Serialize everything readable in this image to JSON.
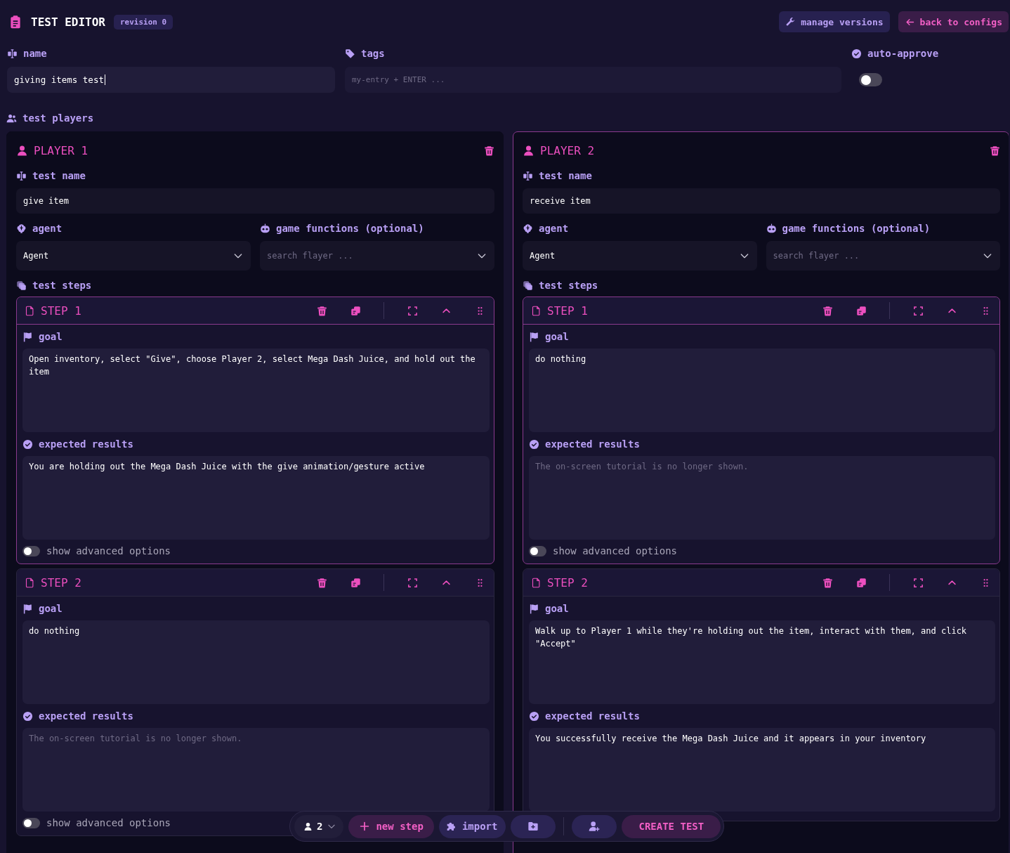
{
  "header": {
    "title": "TEST EDITOR",
    "badge": "revision 0",
    "buttons": [
      {
        "kind": "tool",
        "label": "manage versions"
      },
      {
        "kind": "back",
        "label": "back to configs"
      }
    ]
  },
  "fields": {
    "name": {
      "label": "name",
      "value": "giving items test"
    },
    "tags": {
      "label": "tags",
      "placeholder": "my-entry + ENTER ..."
    },
    "auto_approve": {
      "label": "auto-approve",
      "on": false
    }
  },
  "players_label": "test players",
  "players": [
    {
      "title": "PLAYER 1",
      "selected": false,
      "test_name_label": "test name",
      "test_name": "give item",
      "agent_label": "agent",
      "agent": "Agent",
      "functions_label": "game functions (optional)",
      "functions_placeholder": "search flayer ...",
      "steps_label": "test steps",
      "steps": [
        {
          "title": "STEP 1",
          "selected": true,
          "goal_label": "goal",
          "goal": {
            "value": "Open inventory, select \"Give\", choose Player 2, select Mega Dash Juice, and hold out the item"
          },
          "expected_label": "expected results",
          "expected": {
            "value": "You are holding out the Mega Dash Juice with the give animation/gesture active"
          },
          "advanced_label": "show advanced options",
          "advanced": false
        },
        {
          "title": "STEP 2",
          "selected": false,
          "goal_label": "goal",
          "goal": {
            "value": "do nothing"
          },
          "expected_label": "expected results",
          "expected": {
            "placeholder": "The on-screen tutorial is no longer shown."
          },
          "advanced_label": "show advanced options",
          "advanced": false
        }
      ]
    },
    {
      "title": "PLAYER 2",
      "selected": true,
      "test_name_label": "test name",
      "test_name": "receive item",
      "agent_label": "agent",
      "agent": "Agent",
      "functions_label": "game functions (optional)",
      "functions_placeholder": "search flayer ...",
      "steps_label": "test steps",
      "steps": [
        {
          "title": "STEP 1",
          "selected": true,
          "goal_label": "goal",
          "goal": {
            "value": "do nothing"
          },
          "expected_label": "expected results",
          "expected": {
            "placeholder": "The on-screen tutorial is no longer shown."
          },
          "advanced_label": "show advanced options",
          "advanced": false
        },
        {
          "title": "STEP 2",
          "selected": false,
          "goal_label": "goal",
          "goal": {
            "value": "Walk up to Player 1 while they're holding out the item, interact with them, and click \"Accept\""
          },
          "expected_label": "expected results",
          "expected": {
            "value": "You successfully receive the Mega Dash Juice and it appears in your inventory"
          }
        }
      ]
    }
  ],
  "toolbar": {
    "player_count": "2",
    "buttons": [
      {
        "kind": "new",
        "label": "new step"
      },
      {
        "kind": "import",
        "label": "import"
      },
      {
        "kind": "folder"
      },
      {
        "kind": "add-player"
      },
      {
        "kind": "create",
        "label": "CREATE TEST"
      }
    ]
  }
}
